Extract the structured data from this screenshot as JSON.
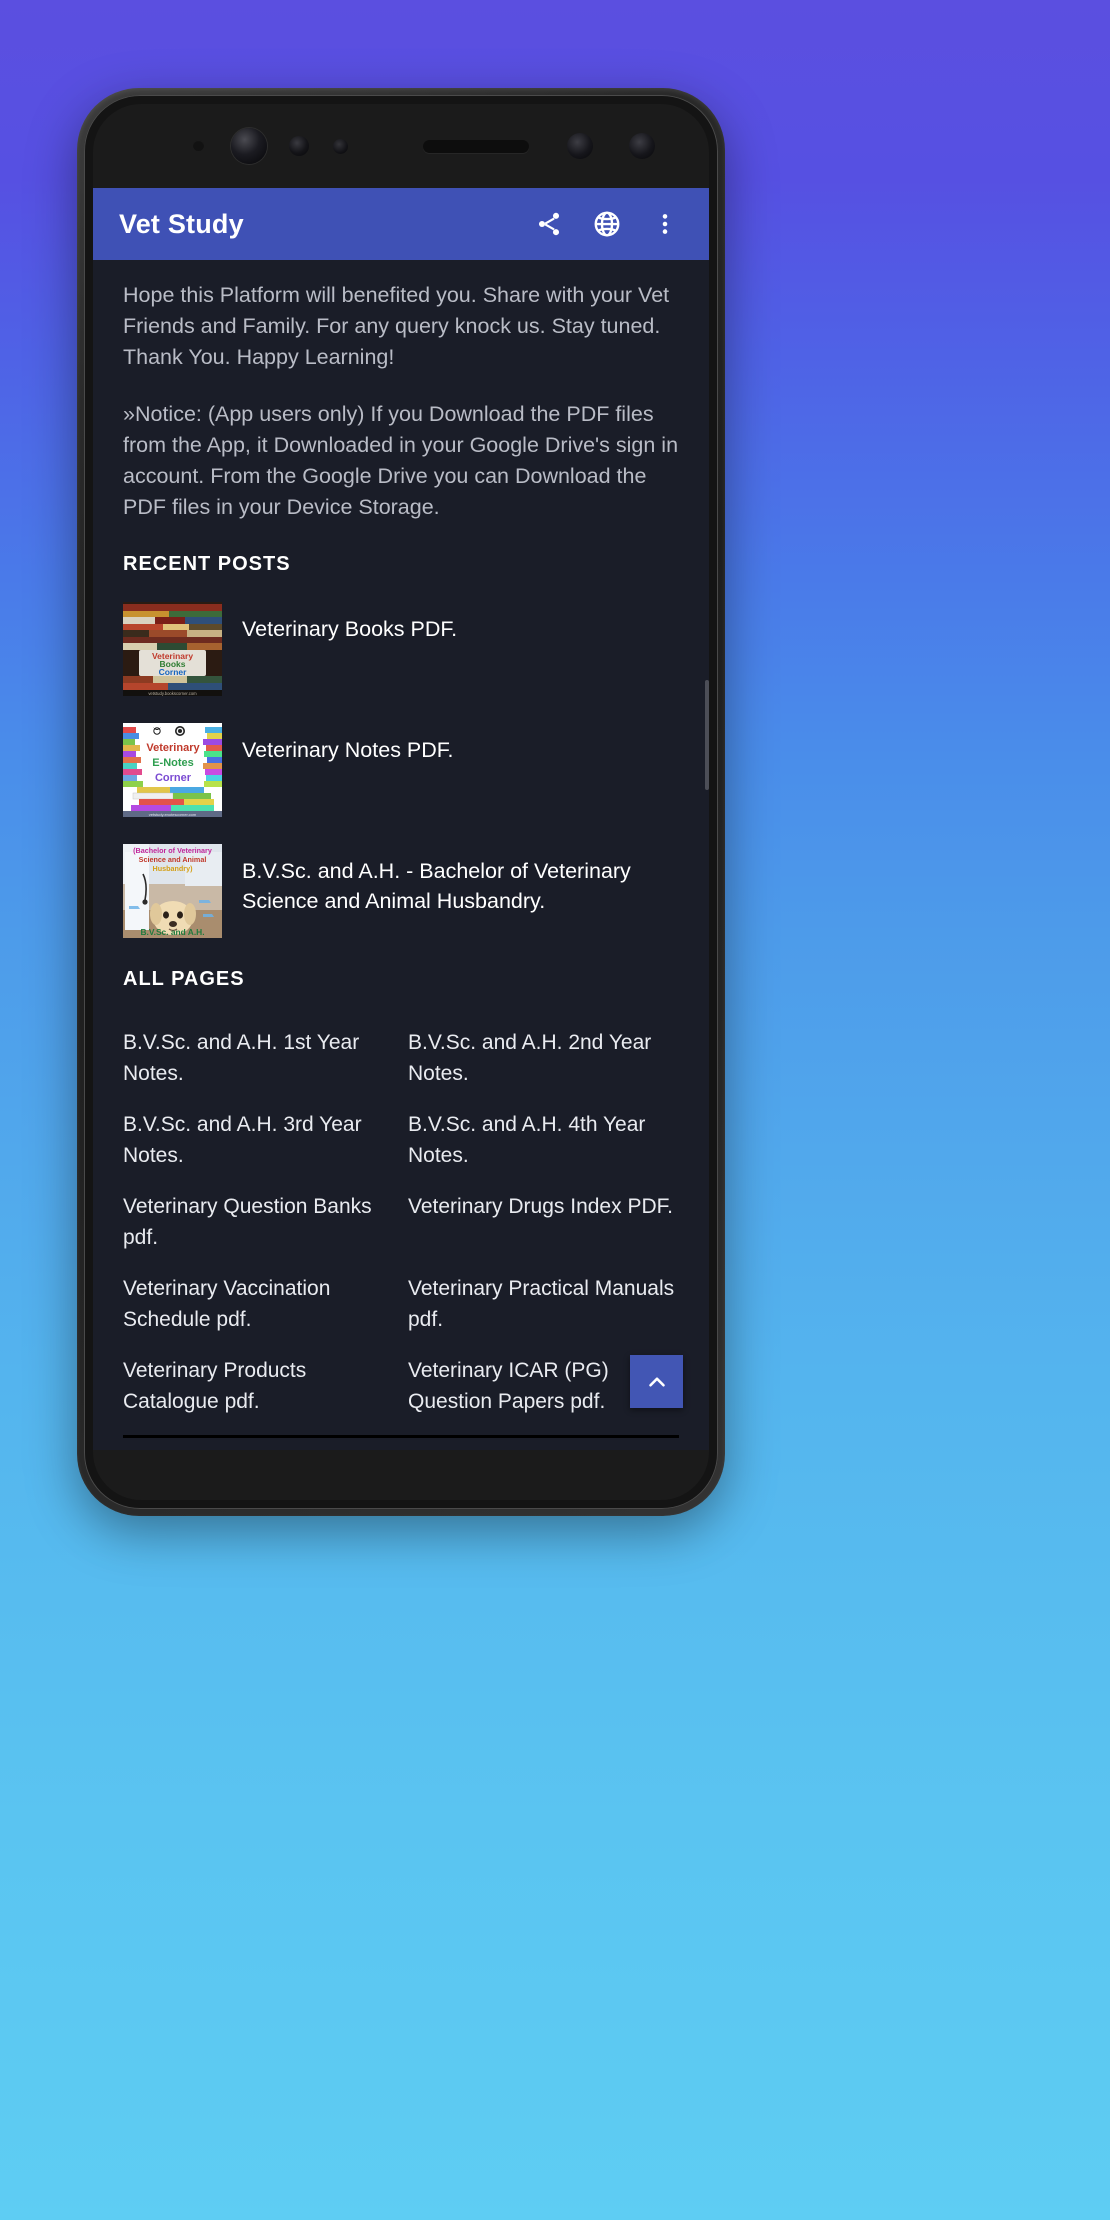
{
  "app": {
    "title": "Vet Study",
    "appbar_color": "#3F51B5",
    "background_color": "#1A1D28",
    "actions": [
      {
        "name": "share-icon",
        "label": "Share"
      },
      {
        "name": "globe-icon",
        "label": "Open in browser"
      },
      {
        "name": "overflow-menu-icon",
        "label": "More options"
      }
    ]
  },
  "content": {
    "paragraph_1": "Hope this Platform will benefited you. Share with your Vet Friends and Family. For any query knock us. Stay tuned. Thank You. Happy Learning!",
    "paragraph_2": "»Notice: (App users only) If you Download the PDF files from the App, it Downloaded in your Google Drive's sign in account. From the Google Drive you can Download the PDF files in your Device Storage.",
    "recent_posts_heading": "RECENT POSTS",
    "recent_posts": [
      {
        "title": "Veterinary Books PDF.",
        "thumb_name": "veterinary-books-corner-thumbnail",
        "thumb_caption_line1": "Veterinary",
        "thumb_caption_line2": "Books",
        "thumb_caption_line3": "Corner"
      },
      {
        "title": "Veterinary Notes PDF.",
        "thumb_name": "veterinary-e-notes-corner-thumbnail",
        "thumb_caption_line1": "Veterinary",
        "thumb_caption_line2": "E-Notes",
        "thumb_caption_line3": "Corner"
      },
      {
        "title": "B.V.Sc. and A.H. - Bachelor of Veterinary Science and Animal Husbandry.",
        "thumb_name": "bvsc-and-ah-thumbnail",
        "thumb_caption_line1": "(Bachelor of Veterinary",
        "thumb_caption_line2": "Science and Animal",
        "thumb_caption_line3": "Husbandry)",
        "thumb_caption_line4": "B.V.Sc. and A.H."
      }
    ],
    "all_pages_heading": "ALL PAGES",
    "all_pages": [
      "B.V.Sc. and A.H. 1st Year Notes.",
      "B.V.Sc. and A.H. 2nd Year Notes.",
      "B.V.Sc. and A.H. 3rd Year Notes.",
      "B.V.Sc. and A.H. 4th Year Notes.",
      "Veterinary Question Banks pdf.",
      "Veterinary Drugs Index PDF.",
      "Veterinary Vaccination Schedule pdf.",
      "Veterinary Practical Manuals pdf.",
      "Veterinary Products Catalogue pdf.",
      "Veterinary ICAR (PG) Question Papers pdf."
    ]
  },
  "fab": {
    "name": "scroll-to-top-button",
    "icon": "chevron-up-icon",
    "color": "#4256B4"
  }
}
